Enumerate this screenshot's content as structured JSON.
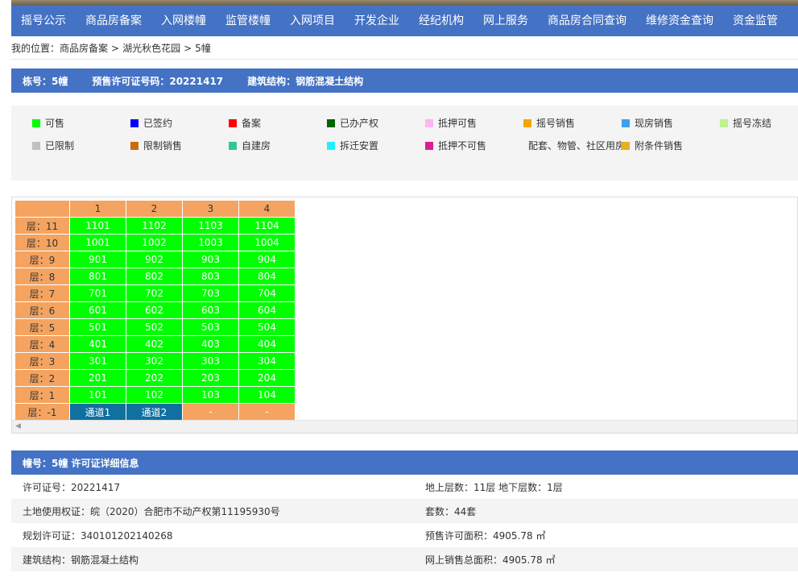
{
  "nav": {
    "items": [
      "摇号公示",
      "商品房备案",
      "入网楼幢",
      "监管楼幢",
      "入网项目",
      "开发企业",
      "经纪机构",
      "网上服务",
      "商品房合同查询",
      "维修资金查询",
      "资金监管"
    ]
  },
  "breadcrumb": {
    "prefix": "我的位置：",
    "path": [
      "商品房备案",
      "湖光秋色花园",
      "5幢"
    ],
    "separator": ">"
  },
  "infobar": {
    "building": "栋号：5幢",
    "permit": "预售许可证号码：20221417",
    "structure": "建筑结构：钢筋混凝土结构"
  },
  "legend": [
    {
      "label": "可售",
      "color": "#00ff00"
    },
    {
      "label": "已签约",
      "color": "#0000ff"
    },
    {
      "label": "备案",
      "color": "#ff0000"
    },
    {
      "label": "已办产权",
      "color": "#006400"
    },
    {
      "label": "抵押可售",
      "color": "#ffb6f0"
    },
    {
      "label": "摇号销售",
      "color": "#f5a500"
    },
    {
      "label": "现房销售",
      "color": "#3aa0ef"
    },
    {
      "label": "摇号冻结",
      "color": "#c0f090"
    },
    {
      "label": "已限制",
      "color": "#c0c0c0"
    },
    {
      "label": "限制销售",
      "color": "#d06a10"
    },
    {
      "label": "自建房",
      "color": "#30c890"
    },
    {
      "label": "拆迁安置",
      "color": "#20f0ff"
    },
    {
      "label": "抵押不可售",
      "color": "#d82090"
    },
    {
      "label": "配套、物管、社区用房",
      "color": "#1070a0"
    },
    {
      "label": "附条件销售",
      "color": "#e8b020"
    }
  ],
  "grid": {
    "columns": [
      "1",
      "2",
      "3",
      "4"
    ],
    "rows": [
      {
        "floor": "层：11",
        "units": [
          "1101",
          "1102",
          "1103",
          "1104"
        ]
      },
      {
        "floor": "层：10",
        "units": [
          "1001",
          "1002",
          "1003",
          "1004"
        ]
      },
      {
        "floor": "层：9",
        "units": [
          "901",
          "902",
          "903",
          "904"
        ]
      },
      {
        "floor": "层：8",
        "units": [
          "801",
          "802",
          "803",
          "804"
        ]
      },
      {
        "floor": "层：7",
        "units": [
          "701",
          "702",
          "703",
          "704"
        ]
      },
      {
        "floor": "层：6",
        "units": [
          "601",
          "602",
          "603",
          "604"
        ]
      },
      {
        "floor": "层：5",
        "units": [
          "501",
          "502",
          "503",
          "504"
        ]
      },
      {
        "floor": "层：4",
        "units": [
          "401",
          "402",
          "403",
          "404"
        ]
      },
      {
        "floor": "层：3",
        "units": [
          "301",
          "302",
          "303",
          "304"
        ]
      },
      {
        "floor": "层：2",
        "units": [
          "201",
          "202",
          "203",
          "204"
        ]
      },
      {
        "floor": "层：1",
        "units": [
          "101",
          "102",
          "103",
          "104"
        ]
      }
    ],
    "basement": {
      "floor": "层：-1",
      "units": [
        "通道1",
        "通道2",
        "-",
        "-"
      ]
    }
  },
  "detail": {
    "title": "幢号：5幢 许可证详细信息",
    "rows": [
      {
        "left": "许可证号：20221417",
        "right": "地上层数：11层  地下层数：1层"
      },
      {
        "left": "土地使用权证：皖（2020）合肥市不动产权第11195930号",
        "right": "套数：44套"
      },
      {
        "left": "规划许可证：340101202140268",
        "right": "预售许可面积：4905.78 ㎡"
      },
      {
        "left": "建筑结构：钢筋混凝土结构",
        "right": "网上销售总面积：4905.78 ㎡"
      }
    ]
  }
}
